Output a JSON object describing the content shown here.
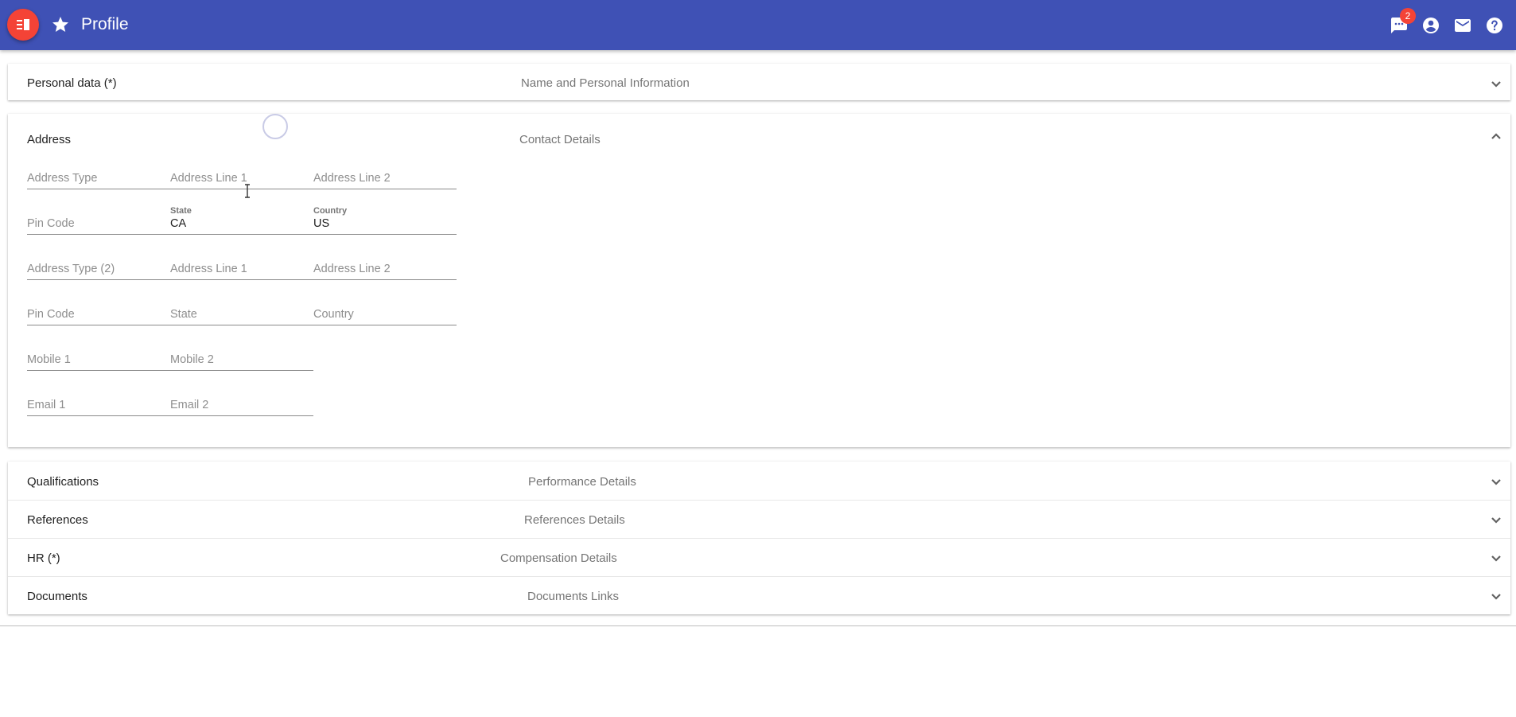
{
  "app": {
    "title": "Profile",
    "messages_badge": "2",
    "accent_color": "#3f51b5",
    "fab_color": "#f44336",
    "icons": {
      "menu": "menu-book-icon",
      "favorite": "star-icon",
      "messages": "chat-icon",
      "account": "account-circle-icon",
      "mail": "mail-icon",
      "help": "help-icon"
    }
  },
  "panels": [
    {
      "title": "Personal data (*)",
      "description": "Name and Personal Information",
      "expanded": false
    },
    {
      "title": "Address",
      "description": "Contact Details",
      "expanded": true
    },
    {
      "title": "Qualifications",
      "description": "Performance Details",
      "expanded": false
    },
    {
      "title": "References",
      "description": "References Details",
      "expanded": false
    },
    {
      "title": "HR (*)",
      "description": "Compensation Details",
      "expanded": false
    },
    {
      "title": "Documents",
      "description": "Documents Links",
      "expanded": false
    }
  ],
  "address_form": {
    "address_type": {
      "placeholder": "Address Type",
      "value": ""
    },
    "address_line1": {
      "placeholder": "Address Line 1",
      "value": ""
    },
    "address_line2": {
      "placeholder": "Address Line 2",
      "value": ""
    },
    "pin_code": {
      "placeholder": "Pin Code",
      "value": ""
    },
    "state": {
      "label": "State",
      "value": "CA"
    },
    "country": {
      "label": "Country",
      "value": "US"
    },
    "address_type2": {
      "placeholder": "Address Type (2)",
      "value": ""
    },
    "address2_line1": {
      "placeholder": "Address Line 1",
      "value": ""
    },
    "address2_line2": {
      "placeholder": "Address Line 2",
      "value": ""
    },
    "pin_code2": {
      "placeholder": "Pin Code",
      "value": ""
    },
    "state2": {
      "placeholder": "State",
      "value": ""
    },
    "country2": {
      "placeholder": "Country",
      "value": ""
    },
    "mobile1": {
      "placeholder": "Mobile 1",
      "value": ""
    },
    "mobile2": {
      "placeholder": "Mobile 2",
      "value": ""
    },
    "email1": {
      "placeholder": "Email 1",
      "value": ""
    },
    "email2": {
      "placeholder": "Email 2",
      "value": ""
    }
  }
}
